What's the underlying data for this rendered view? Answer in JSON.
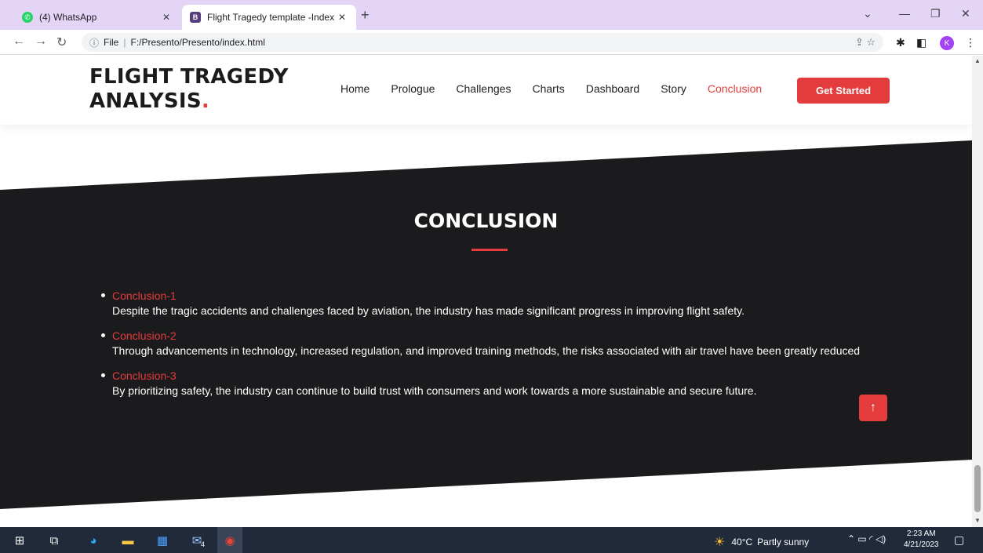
{
  "browser": {
    "tabs": [
      {
        "title": "(4) WhatsApp",
        "favicon": "whatsapp-icon",
        "active": false
      },
      {
        "title": "Flight Tragedy template -Index",
        "favicon": "bootstrap-icon",
        "favicon_letter": "B",
        "active": true
      }
    ],
    "new_tab": "+",
    "address": {
      "scheme_label": "File",
      "url": "F:/Presento/Presento/index.html"
    },
    "profile_initial": "K"
  },
  "site": {
    "logo_line1": "FLIGHT TRAGEDY",
    "logo_line2": "ANALYSIS",
    "logo_dot": ".",
    "nav": [
      "Home",
      "Prologue",
      "Challenges",
      "Charts",
      "Dashboard",
      "Story",
      "Conclusion"
    ],
    "active_nav": "Conclusion",
    "cta_label": "Get Started"
  },
  "section": {
    "title": "CONCLUSION",
    "items": [
      {
        "label": "Conclusion-1",
        "text": "Despite the tragic accidents and challenges faced by aviation, the industry has made significant progress in improving flight safety."
      },
      {
        "label": "Conclusion-2",
        "text": "Through advancements in technology, increased regulation, and improved training methods, the risks associated with air travel have been greatly reduced"
      },
      {
        "label": "Conclusion-3",
        "text": "By prioritizing safety, the industry can continue to build trust with consumers and work towards a more sustainable and secure future."
      }
    ]
  },
  "taskbar": {
    "weather_temp": "40°C",
    "weather_desc": "Partly sunny",
    "time": "2:23 AM",
    "date": "4/21/2023",
    "mail_badge": "4"
  },
  "colors": {
    "accent": "#e43c3c",
    "dark_band": "#1b1b1d",
    "tabbar": "#e4d5f7"
  }
}
